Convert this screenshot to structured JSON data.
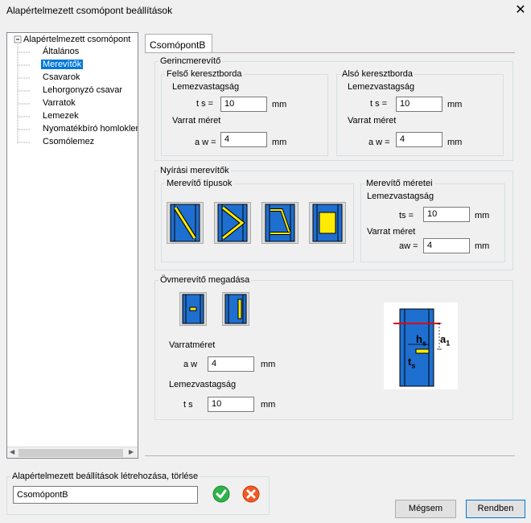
{
  "window": {
    "title": "Alapértelmezett csomópont beállítások",
    "close": "✕"
  },
  "tree": {
    "root": "Alapértelmezett csomópont",
    "items": [
      "Általános",
      "Merevítők",
      "Csavarok",
      "Lehorgonyzó csavar",
      "Varratok",
      "Lemezek",
      "Nyomatékbíró homloklem",
      "Csomólemez"
    ],
    "selected": "Merevítők"
  },
  "tab": {
    "label": "CsomópontB"
  },
  "gerinc": {
    "title": "Gerincmerevítő",
    "felso": {
      "title": "Felső keresztborda",
      "lemez_label": "Lemezvastagság",
      "ts_label": "t s =",
      "ts_value": "10",
      "ts_unit": "mm",
      "varrat_label": "Varrat méret",
      "aw_label": "a w =",
      "aw_value": "4",
      "aw_unit": "mm"
    },
    "also": {
      "title": "Alsó keresztborda",
      "lemez_label": "Lemezvastagság",
      "ts_label": "t s =",
      "ts_value": "10",
      "ts_unit": "mm",
      "varrat_label": "Varrat méret",
      "aw_label": "a w =",
      "aw_value": "4",
      "aw_unit": "mm"
    }
  },
  "nyirasi": {
    "title": "Nyírási merevítők",
    "tipusok_title": "Merevítő típusok",
    "meretei": {
      "title": "Merevítő méretei",
      "lemez_label": "Lemezvastagság",
      "ts_label": "ts =",
      "ts_value": "10",
      "ts_unit": "mm",
      "varrat_label": "Varrat méret",
      "aw_label": "aw =",
      "aw_value": "4",
      "aw_unit": "mm"
    }
  },
  "ov": {
    "title": "Övmerevítő megadása",
    "varrat_label": "Varratméret",
    "aw_label": "a w",
    "aw_value": "4",
    "aw_unit": "mm",
    "lemez_label": "Lemezvastagság",
    "ts_label": "t s",
    "ts_value": "10",
    "ts_unit": "mm",
    "diagram": {
      "hs": "h",
      "hs_sub": "s",
      "ts": "t",
      "ts_sub": "s",
      "a1": "a",
      "a1_sub": "1"
    }
  },
  "defaults": {
    "title": "Alapértelmezett beállítások létrehozása, törlése",
    "name_value": "CsomópontB"
  },
  "buttons": {
    "cancel": "Mégsem",
    "ok": "Rendben"
  },
  "colors": {
    "steel": "#1e6fd0",
    "plate": "#ffea00",
    "select": "#0078d7"
  }
}
